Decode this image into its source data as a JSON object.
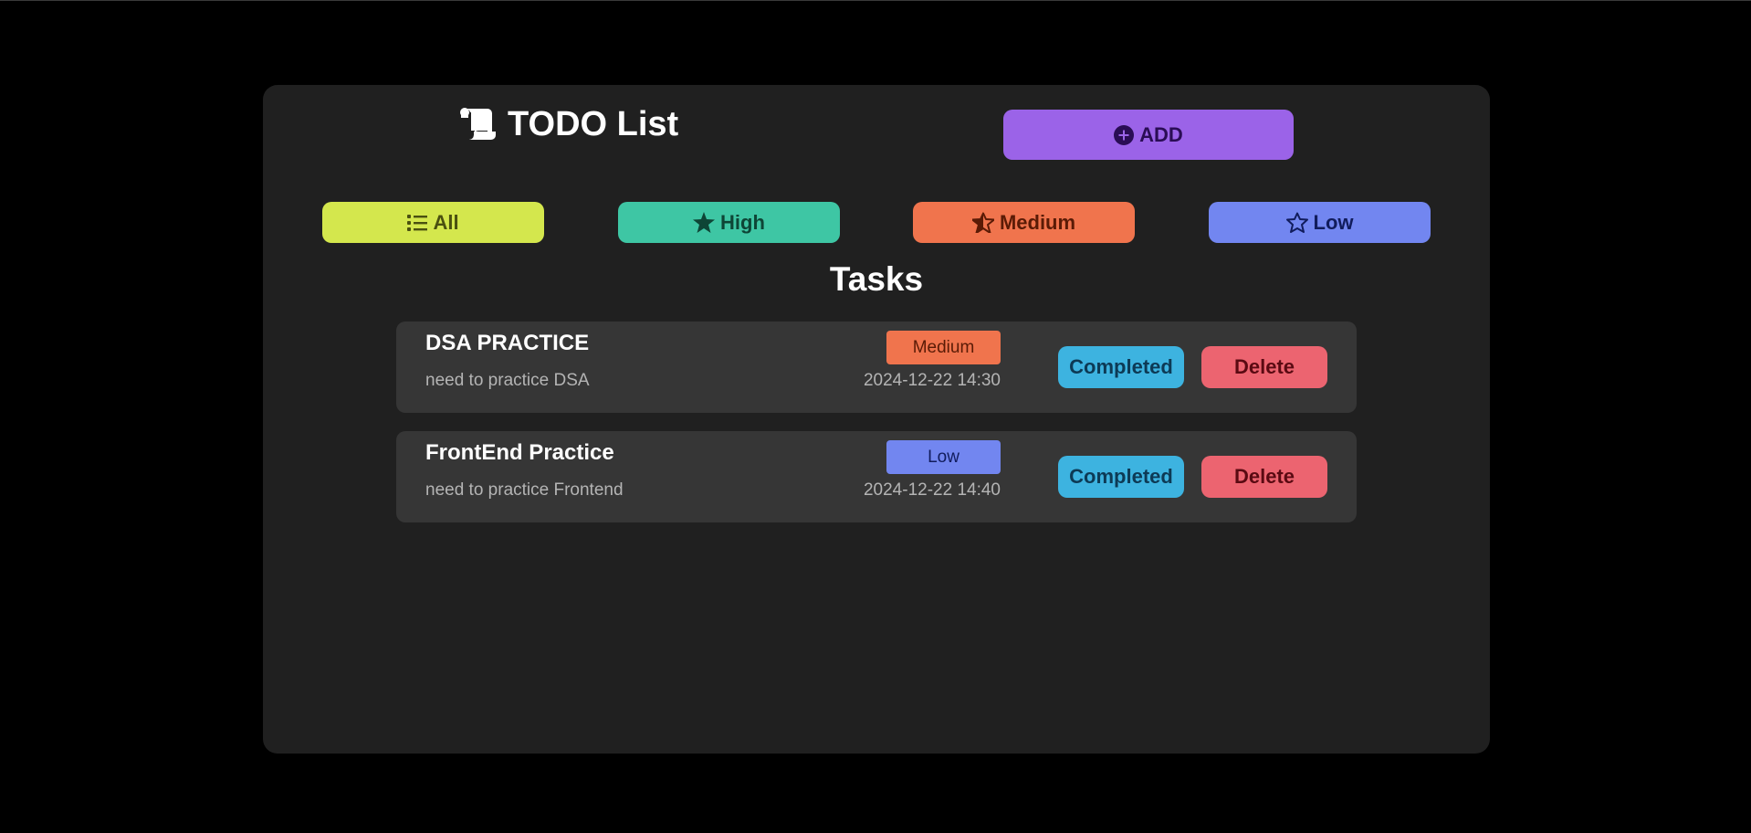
{
  "header": {
    "title": "TODO List",
    "title_icon": "scroll-icon",
    "add_label": "ADD",
    "add_icon": "plus-circle-icon"
  },
  "filters": {
    "all": {
      "label": "All",
      "icon": "list-icon",
      "color": "#d4e74d"
    },
    "high": {
      "label": "High",
      "icon": "star-solid-icon",
      "color": "#3ec6a4"
    },
    "medium": {
      "label": "Medium",
      "icon": "star-half-icon",
      "color": "#f0744d"
    },
    "low": {
      "label": "Low",
      "icon": "star-outline-icon",
      "color": "#7286f0"
    }
  },
  "tasks_heading": "Tasks",
  "tasks": [
    {
      "title": "DSA PRACTICE",
      "description": "need to practice DSA",
      "priority": "Medium",
      "datetime": "2024-12-22 14:30",
      "completed_label": "Completed",
      "delete_label": "Delete"
    },
    {
      "title": "FrontEnd Practice",
      "description": "need to practice Frontend",
      "priority": "Low",
      "datetime": "2024-12-22 14:40",
      "completed_label": "Completed",
      "delete_label": "Delete"
    }
  ],
  "colors": {
    "background": "#000000",
    "card": "#202020",
    "task_item": "#363636",
    "add_button": "#9b63e8",
    "completed_button": "#3db3e0",
    "delete_button": "#ec6470"
  }
}
